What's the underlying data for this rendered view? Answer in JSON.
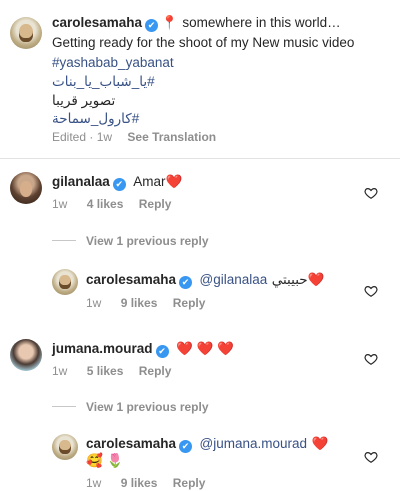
{
  "caption": {
    "username": "carolesamaha",
    "pin_emoji": "📍",
    "line1_rest": "somewhere in this world…",
    "line2": "Getting ready for the shoot of my New music video",
    "line3": "#yashabab_yabanat",
    "line4": "#يا_شباب_يا_بنات",
    "line5": "تصوير قريبا",
    "line6": "#كارول_سماحة",
    "edited": "Edited",
    "time": "1w",
    "see_translation": "See Translation"
  },
  "comments": [
    {
      "username": "gilanalaa",
      "text": "Amar",
      "emoji": "❤️",
      "time": "1w",
      "likes": "4 likes",
      "reply": "Reply",
      "view_replies": "View 1 previous reply",
      "reply_item": {
        "username": "carolesamaha",
        "mention": "@gilanalaa",
        "text": "حبيبتي",
        "emoji": "❤️",
        "time": "1w",
        "likes": "9 likes",
        "reply": "Reply"
      }
    },
    {
      "username": "jumana.mourad",
      "emoji": "❤️ ❤️ ❤️",
      "time": "1w",
      "likes": "5 likes",
      "reply": "Reply",
      "view_replies": "View 1 previous reply",
      "reply_item": {
        "username": "carolesamaha",
        "mention": "@jumana.mourad",
        "emoji": "❤️",
        "line2_emoji": "🥰 🌷",
        "time": "1w",
        "likes": "9 likes",
        "reply": "Reply"
      }
    }
  ],
  "icons": {
    "verified": "✔",
    "like": "heart-outline-icon"
  },
  "colors": {
    "text": "#262626",
    "muted": "#8e8e8e",
    "link": "#385185",
    "verified": "#3897f0",
    "heart": "#ed1c24"
  }
}
